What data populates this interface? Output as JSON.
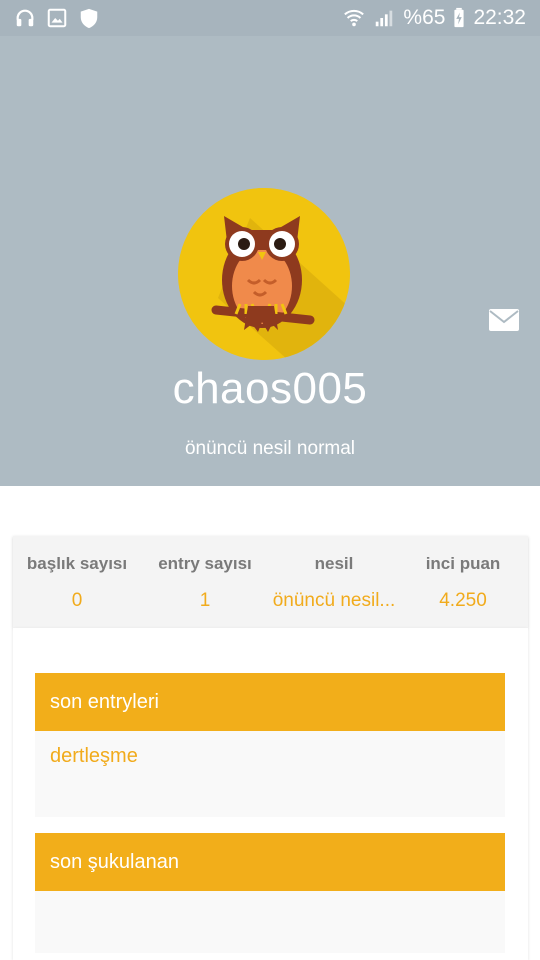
{
  "status_bar": {
    "battery": "%65",
    "time": "22:32",
    "left_icons": [
      "headphones-icon",
      "image-icon",
      "shield-icon"
    ],
    "right_icons": [
      "wifi-icon",
      "signal-icon",
      "battery-icon"
    ]
  },
  "profile": {
    "username": "chaos005",
    "generation_label": "önüncü nesil normal",
    "avatar": "owl-avatar",
    "message_icon": "mail-icon"
  },
  "stats": [
    {
      "label": "başlık sayısı",
      "value": "0"
    },
    {
      "label": "entry sayısı",
      "value": "1"
    },
    {
      "label": "nesil",
      "value": "önüncü nesil..."
    },
    {
      "label": "inci puan",
      "value": "4.250"
    }
  ],
  "sections": {
    "recent_entries": {
      "title": "son entryleri",
      "items": [
        "dertleşme"
      ]
    },
    "recent_likes": {
      "title": "son şukulanan",
      "items": []
    }
  },
  "colors": {
    "header_bg": "#aebbc3",
    "accent": "#f2ae1a",
    "avatar_bg": "#f1c40f"
  }
}
